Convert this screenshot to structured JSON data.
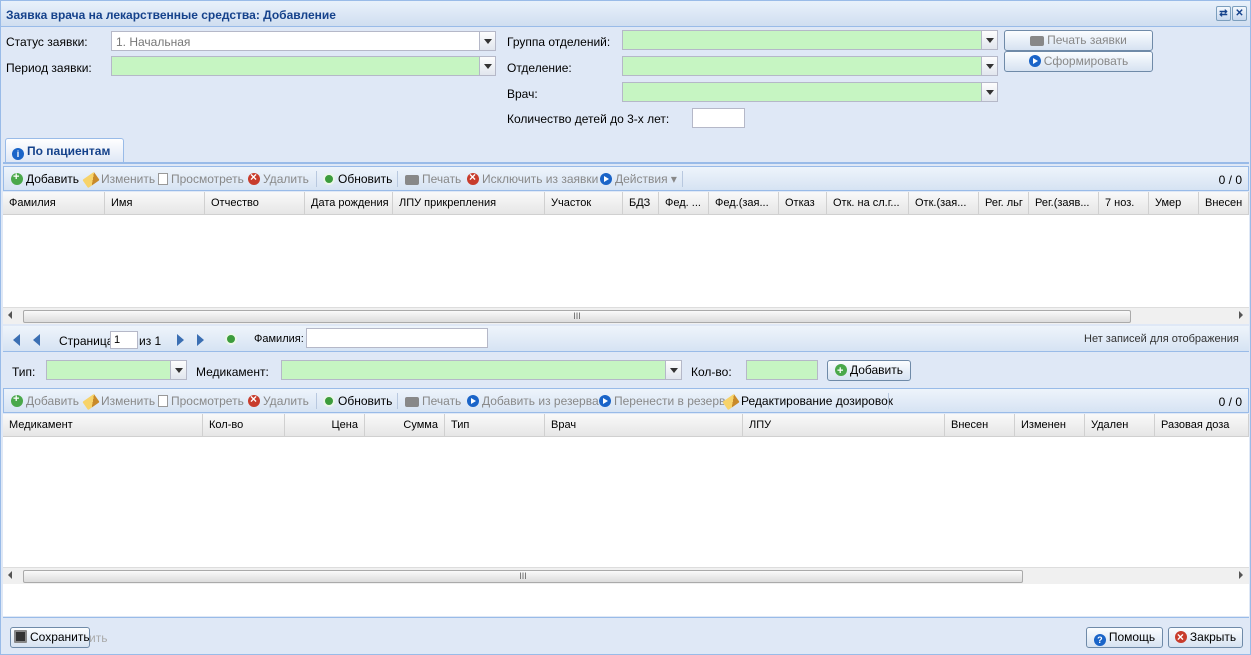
{
  "window": {
    "title": "Заявка врача на лекарственные средства: Добавление"
  },
  "filters": {
    "status_label": "Статус заявки:",
    "status_value": "1. Начальная",
    "period_label": "Период заявки:",
    "group_label": "Группа отделений:",
    "dept_label": "Отделение:",
    "doctor_label": "Врач:",
    "children_label": "Количество детей до 3-х лет:",
    "print_button": "Печать заявки",
    "form_button": "Сформировать"
  },
  "tab": {
    "label": "По пациентам"
  },
  "toolbar1": {
    "add": "Добавить",
    "edit": "Изменить",
    "view": "Просмотреть",
    "delete": "Удалить",
    "refresh": "Обновить",
    "print": "Печать",
    "exclude": "Исключить из заявки",
    "actions": "Действия",
    "count": "0 / 0"
  },
  "grid1": {
    "columns": [
      "Фамилия",
      "Имя",
      "Отчество",
      "Дата рождения",
      "ЛПУ прикрепления",
      "Участок",
      "БДЗ",
      "Фед. ...",
      "Фед.(зая...",
      "Отказ",
      "Отк. на сл.г...",
      "Отк.(зая...",
      "Рег. льг",
      "Рег.(заяв...",
      "7 ноз.",
      "Умер",
      "Внесен"
    ]
  },
  "pager": {
    "page_label": "Страница",
    "page_value": "1",
    "of_label": "из 1",
    "surname_label": "Фамилия:",
    "empty_text": "Нет записей для отображения"
  },
  "addform": {
    "type_label": "Тип:",
    "drug_label": "Медикамент:",
    "qty_label": "Кол-во:",
    "add_button": "Добавить"
  },
  "toolbar2": {
    "add": "Добавить",
    "edit": "Изменить",
    "view": "Просмотреть",
    "delete": "Удалить",
    "refresh": "Обновить",
    "print": "Печать",
    "add_reserve": "Добавить из резерва",
    "move_reserve": "Перенести в резерв",
    "dosage": "Редактирование дозировок",
    "count": "0 / 0"
  },
  "grid2": {
    "columns": [
      "Медикамент",
      "Кол-во",
      "Цена",
      "Сумма",
      "Тип",
      "Врач",
      "ЛПУ",
      "Внесен",
      "Изменен",
      "Удален",
      "Разовая доза"
    ]
  },
  "footer": {
    "save": "Сохранить",
    "hidden_text": "ить",
    "help": "Помощь",
    "close": "Закрыть"
  }
}
